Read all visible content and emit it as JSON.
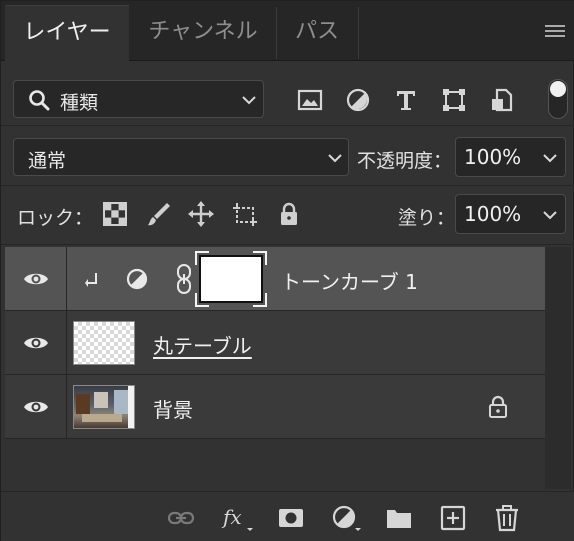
{
  "tabs": [
    {
      "label": "レイヤー",
      "active": true
    },
    {
      "label": "チャンネル",
      "active": false
    },
    {
      "label": "パス",
      "active": false
    }
  ],
  "filter": {
    "label": "種類",
    "icons": [
      "image-filter-icon",
      "adjustment-filter-icon",
      "type-filter-icon",
      "shape-filter-icon",
      "smart-object-filter-icon"
    ]
  },
  "blend": {
    "mode": "通常",
    "opacity_label": "不透明度：",
    "opacity": "100%"
  },
  "lock": {
    "label": "ロック：",
    "fill_label": "塗り：",
    "fill": "100%"
  },
  "layers": [
    {
      "name": "トーンカーブ 1",
      "type": "adjustment",
      "selected": true
    },
    {
      "name": "丸テーブル",
      "type": "pixel",
      "selected": false
    },
    {
      "name": "背景",
      "type": "background",
      "locked": true,
      "selected": false
    }
  ],
  "colors": {
    "panel_bg": "#323232",
    "selected_row": "#545454",
    "text": "#f0f0f0"
  }
}
